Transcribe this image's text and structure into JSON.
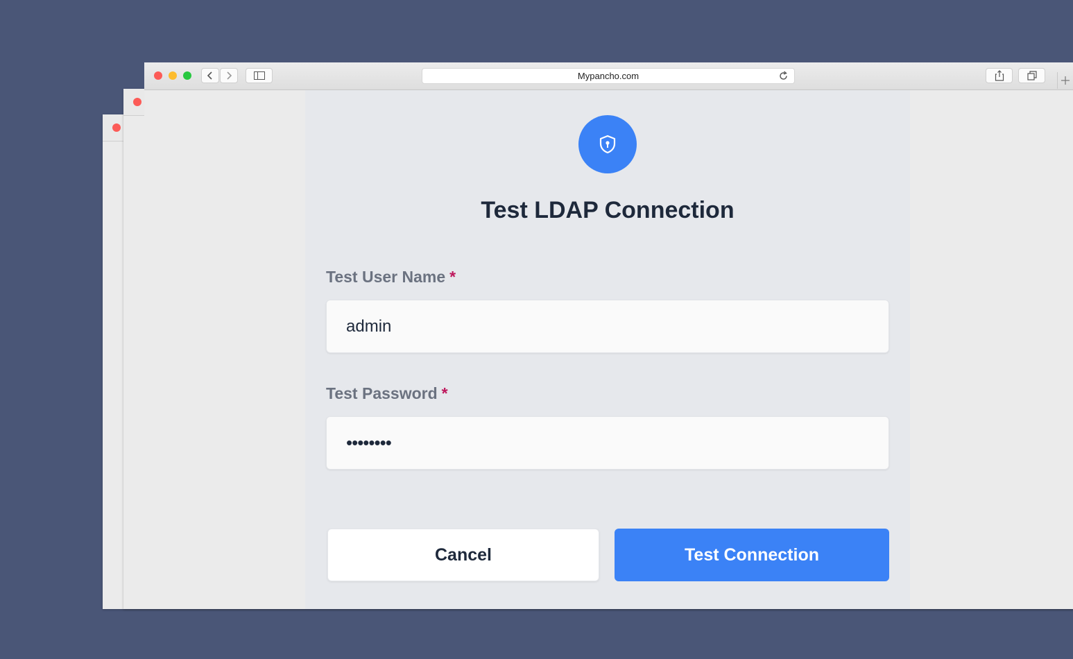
{
  "browser": {
    "url": "Mypancho.com",
    "colors": {
      "close": "#fc5b57",
      "minimize": "#fdbc2e",
      "zoom": "#28c840"
    }
  },
  "icons": {
    "back": "chevron-left-icon",
    "forward": "chevron-right-icon",
    "sidebar": "sidebar-icon",
    "reload": "reload-icon",
    "share": "share-icon",
    "tabs": "tabs-overview-icon",
    "new_tab": "plus-icon",
    "header_badge": "shield-icon"
  },
  "dialog": {
    "title": "Test LDAP Connection",
    "username_label": "Test User Name",
    "username_value": "admin",
    "password_label": "Test Password",
    "password_value": "••••••••",
    "required_marker": "*",
    "cancel_label": "Cancel",
    "submit_label": "Test Connection",
    "accent_color": "#3b82f6"
  }
}
